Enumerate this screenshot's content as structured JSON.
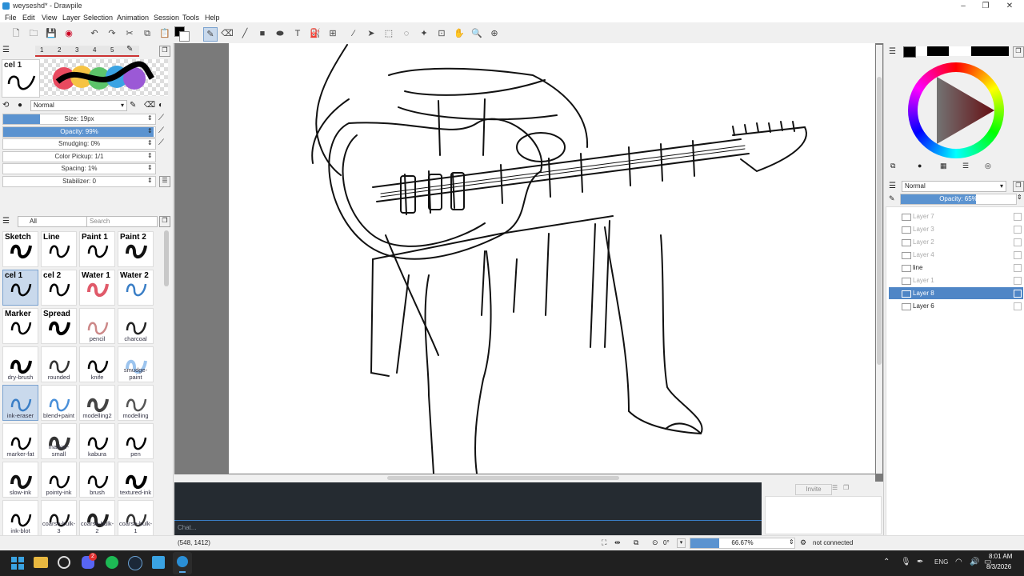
{
  "window": {
    "title": "weyseshd* - Drawpile",
    "controls": [
      "–",
      "❐",
      "✕"
    ]
  },
  "menu": [
    "File",
    "Edit",
    "View",
    "Layer",
    "Selection",
    "Animation",
    "Session",
    "Tools",
    "Help"
  ],
  "brush_settings": {
    "slot_tabs": [
      "1",
      "2",
      "3",
      "4",
      "5"
    ],
    "preview_label": "cel 1",
    "blend_mode": "Normal",
    "sliders": [
      {
        "label": "Size: 19px",
        "fill": 0.24
      },
      {
        "label": "Opacity: 99%",
        "fill": 0.99
      },
      {
        "label": "Smudging: 0%",
        "fill": 0
      },
      {
        "label": "Color Pickup: 1/1",
        "fill": 0
      },
      {
        "label": "Spacing: 1%",
        "fill": 0
      },
      {
        "label": "Stabilizer: 0",
        "fill": 0
      }
    ]
  },
  "brush_library": {
    "filter": "All",
    "search_placeholder": "Search",
    "brushes": [
      {
        "name": "Sketch",
        "label": ""
      },
      {
        "name": "Line",
        "label": ""
      },
      {
        "name": "Paint 1",
        "label": ""
      },
      {
        "name": "Paint 2",
        "label": ""
      },
      {
        "name": "cel 1",
        "label": ""
      },
      {
        "name": "cel 2",
        "label": ""
      },
      {
        "name": "Water 1",
        "label": ""
      },
      {
        "name": "Water 2",
        "label": ""
      },
      {
        "name": "Marker",
        "label": ""
      },
      {
        "name": "Spread",
        "label": ""
      },
      {
        "name": "",
        "label": "pencil"
      },
      {
        "name": "",
        "label": "charcoal"
      },
      {
        "name": "",
        "label": "dry-brush"
      },
      {
        "name": "",
        "label": "rounded"
      },
      {
        "name": "",
        "label": "knife"
      },
      {
        "name": "",
        "label": "smudge-paint"
      },
      {
        "name": "",
        "label": "ink-eraser"
      },
      {
        "name": "",
        "label": "blend+paint"
      },
      {
        "name": "",
        "label": "modelling2"
      },
      {
        "name": "",
        "label": "modelling"
      },
      {
        "name": "",
        "label": "marker-fat"
      },
      {
        "name": "",
        "label": "marker-small"
      },
      {
        "name": "",
        "label": "kabura"
      },
      {
        "name": "",
        "label": "pen"
      },
      {
        "name": "",
        "label": "slow-ink"
      },
      {
        "name": "",
        "label": "pointy-ink"
      },
      {
        "name": "",
        "label": "brush"
      },
      {
        "name": "",
        "label": "textured-ink"
      },
      {
        "name": "",
        "label": "ink-blot"
      },
      {
        "name": "",
        "label": "coarse-bulk-3"
      },
      {
        "name": "",
        "label": "coarse-bulk-2"
      },
      {
        "name": "",
        "label": "coarse-bulk-1"
      }
    ]
  },
  "layers_panel": {
    "blend_mode": "Normal",
    "opacity_label": "Opacity: 65%",
    "opacity_fill": 0.65,
    "layers": [
      {
        "name": "Layer 7",
        "hidden": true,
        "selected": false
      },
      {
        "name": "Layer 3",
        "hidden": true,
        "selected": false
      },
      {
        "name": "Layer 2",
        "hidden": true,
        "selected": false
      },
      {
        "name": "Layer 4",
        "hidden": true,
        "selected": false
      },
      {
        "name": "line",
        "hidden": false,
        "selected": false
      },
      {
        "name": "Layer 1",
        "hidden": true,
        "selected": false
      },
      {
        "name": "Layer 8",
        "hidden": false,
        "selected": true
      },
      {
        "name": "Layer 6",
        "hidden": false,
        "selected": false
      }
    ]
  },
  "chat": {
    "placeholder": "Chat...",
    "invite_label": "Invite"
  },
  "status": {
    "coords": "(548, 1412)",
    "rotation": "0°",
    "zoom": "66.67%",
    "zoom_fill": 0.28,
    "connection": "not connected"
  },
  "taskbar": {
    "language": "ENG",
    "time": "8:01 AM",
    "date": "8/3/2026",
    "badge": "2"
  },
  "colors": {
    "accent": "#4f86c6",
    "slider_fill": "#5b93d0",
    "chat_bg": "#252b31",
    "canvas_bg": "#7a7a7a"
  }
}
